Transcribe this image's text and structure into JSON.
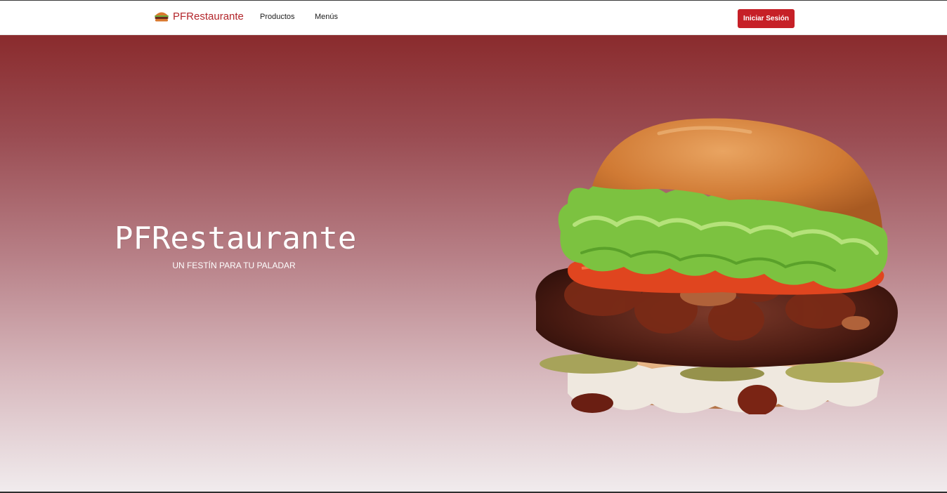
{
  "navbar": {
    "brand": "PFRestaurante",
    "brand_logo_icon": "burger-icon",
    "links": [
      "Productos",
      "Menús"
    ],
    "login_label": "Iniciar Sesión"
  },
  "hero": {
    "title": "PFRestaurante",
    "subtitle": "UN FESTÍN PARA TU PALADAR",
    "image_icon": "burger-image"
  },
  "colors": {
    "accent": "#c62027",
    "brand_text": "#b3262b",
    "hero_top": "#8a2b2d",
    "hero_bottom": "#f1ecee"
  }
}
